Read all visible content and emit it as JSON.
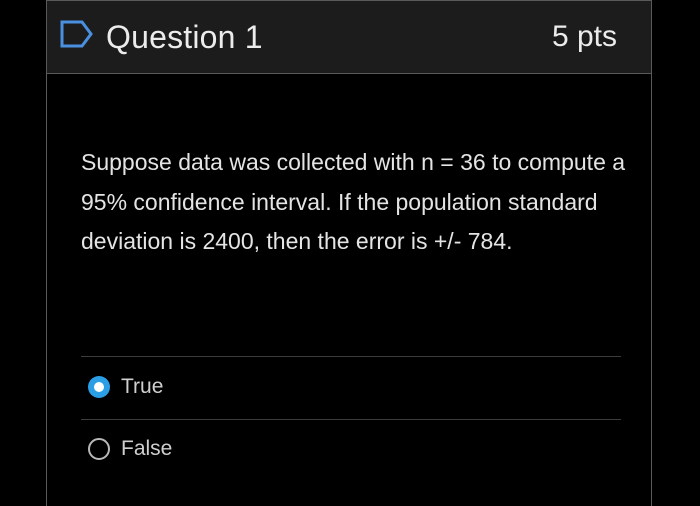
{
  "question": {
    "title": "Question 1",
    "points": "5 pts",
    "flag_icon": "flag-outline-icon",
    "text": "Suppose data was collected with n = 36 to compute a 95% confidence interval.  If the population standard deviation is 2400, then the error is +/- 784."
  },
  "answers": [
    {
      "label": "True",
      "selected": true
    },
    {
      "label": "False",
      "selected": false
    }
  ],
  "colors": {
    "accent": "#2b9fe6",
    "header_bg": "#1c1c1c",
    "page_bg": "#000000"
  }
}
